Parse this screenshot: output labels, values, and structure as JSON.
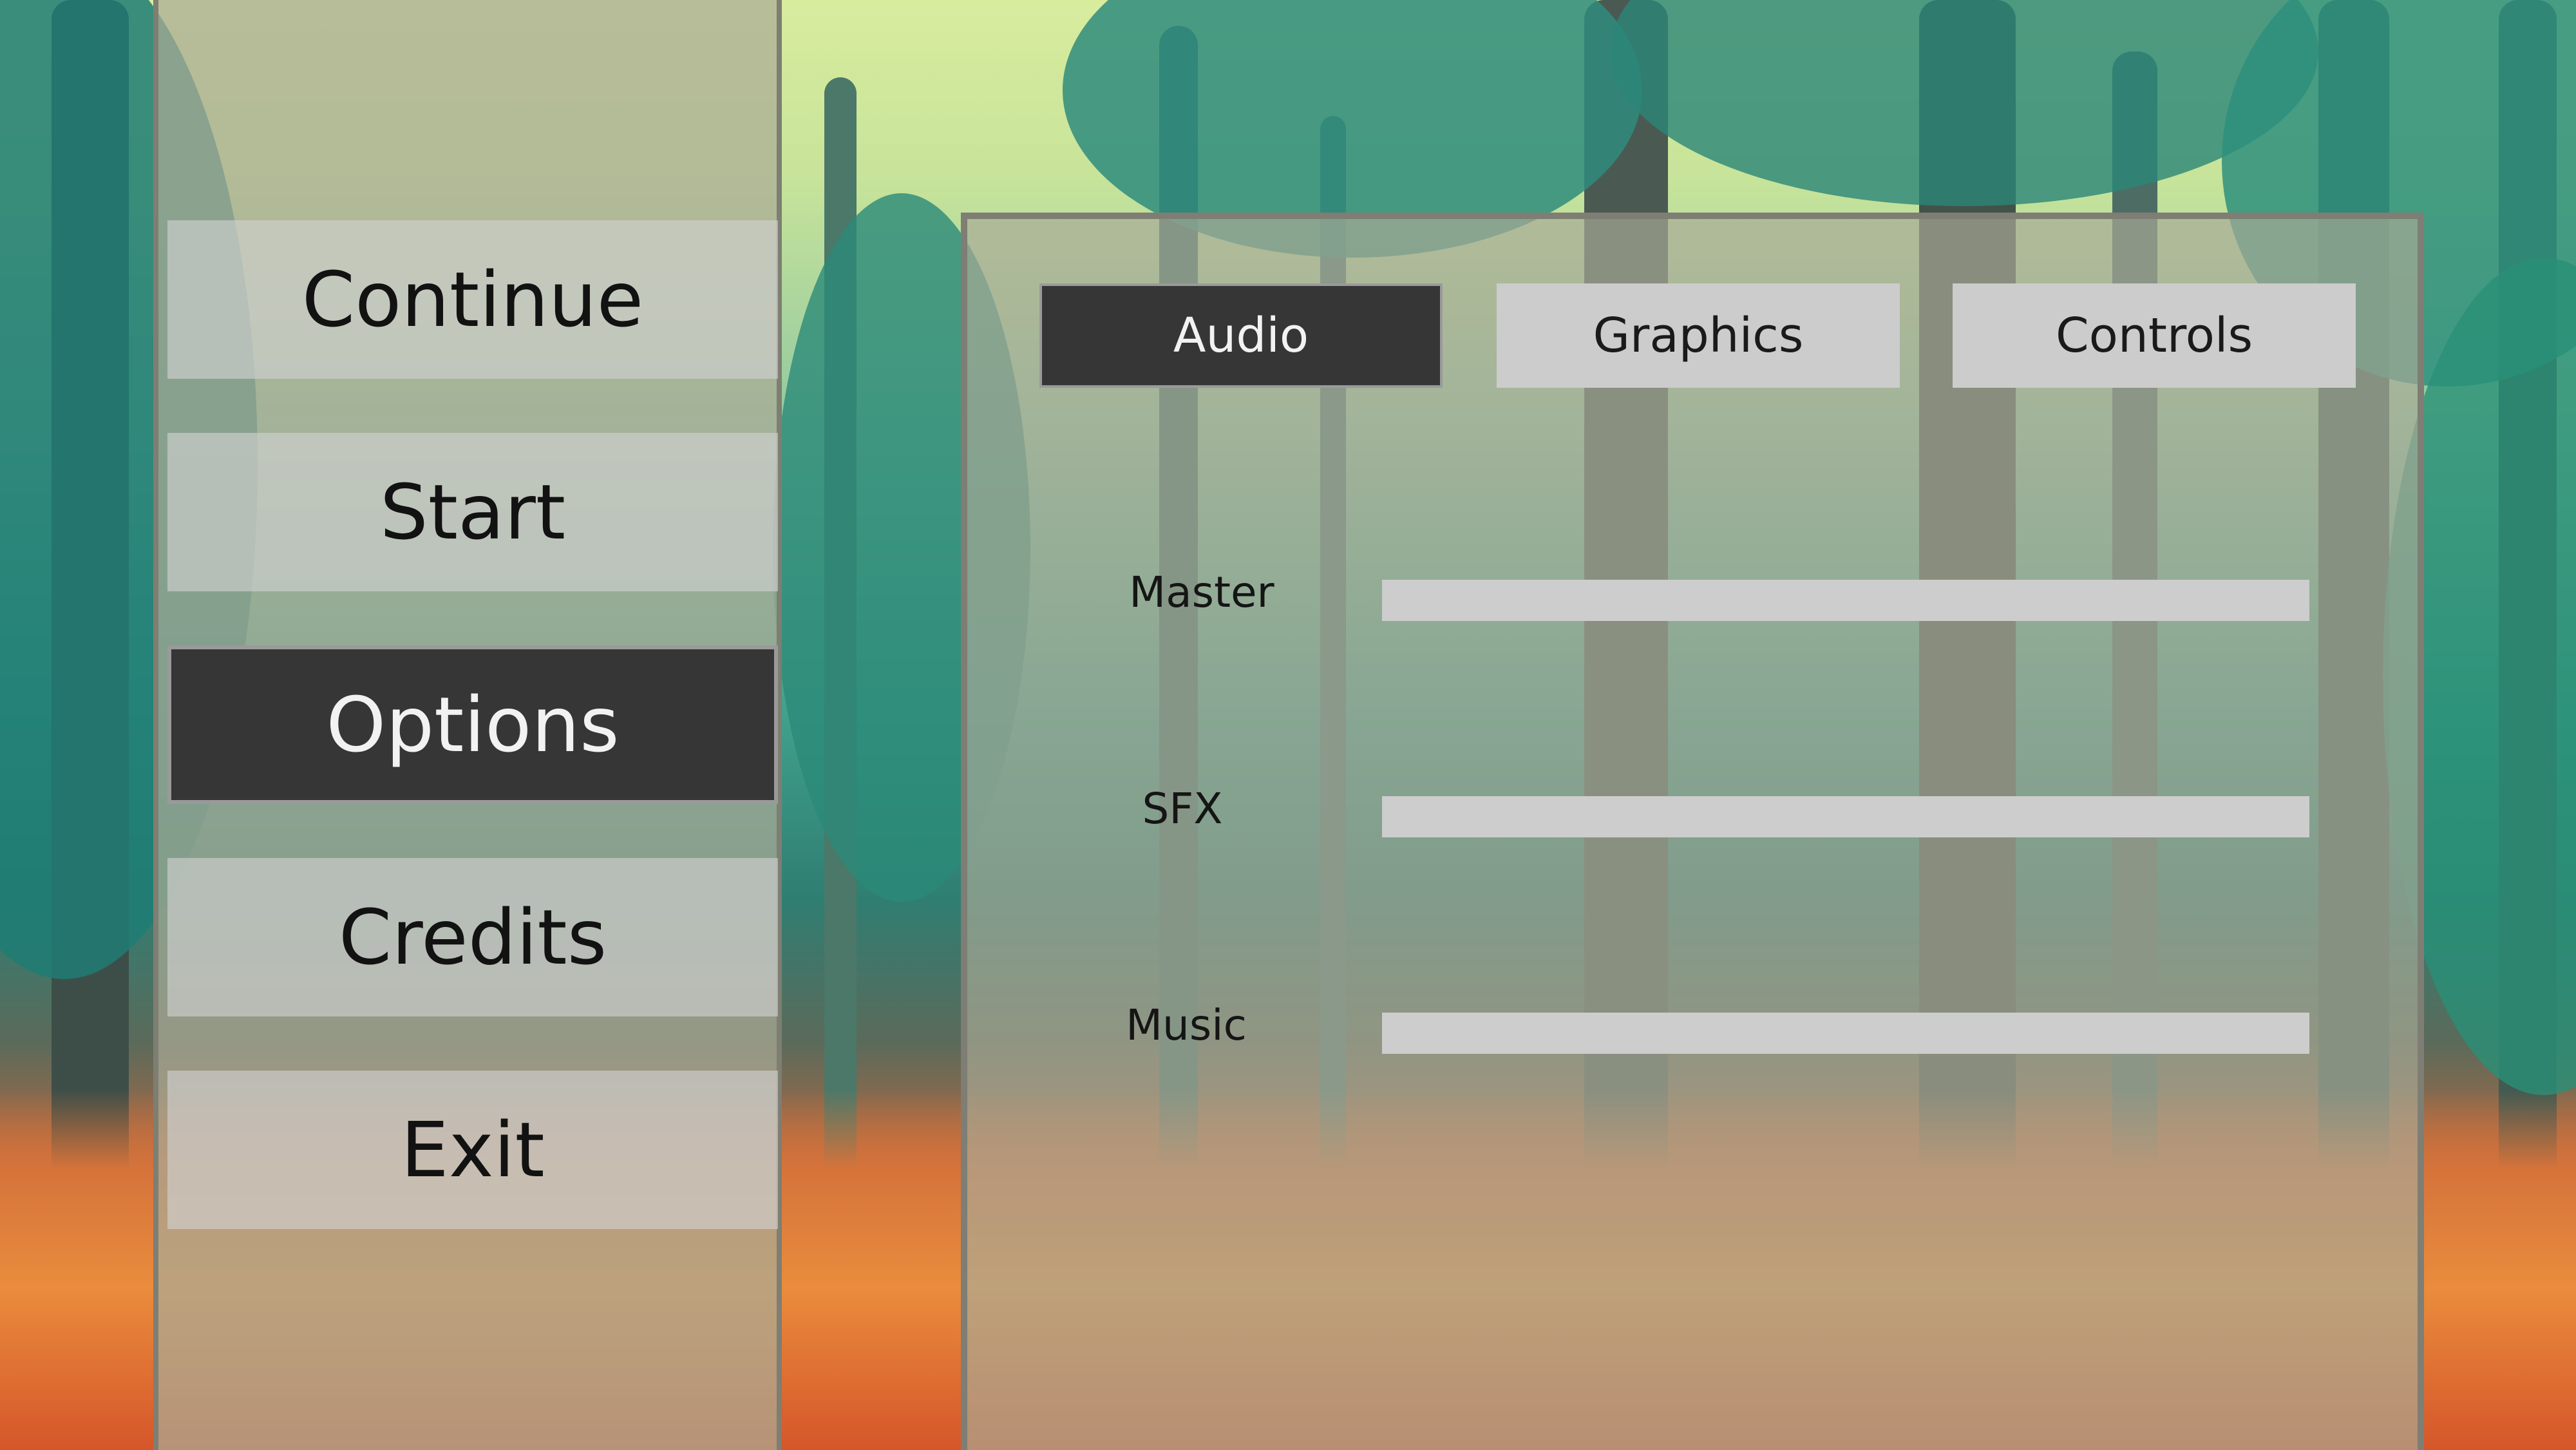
{
  "main_menu": {
    "items": [
      {
        "label": "Continue"
      },
      {
        "label": "Start"
      },
      {
        "label": "Options",
        "active": true
      },
      {
        "label": "Credits"
      },
      {
        "label": "Exit"
      }
    ]
  },
  "options": {
    "tabs": [
      {
        "label": "Audio",
        "active": true
      },
      {
        "label": "Graphics"
      },
      {
        "label": "Controls"
      }
    ],
    "audio": {
      "settings": [
        {
          "label": "Master"
        },
        {
          "label": "SFX"
        },
        {
          "label": "Music"
        }
      ]
    }
  },
  "colors": {
    "active_background": "#363636",
    "button_background": "#cccccc",
    "panel_background": "#aaaa96",
    "text_dark": "#121212",
    "text_light": "#f2f2f2"
  },
  "background": {
    "scene": "forest-background"
  }
}
